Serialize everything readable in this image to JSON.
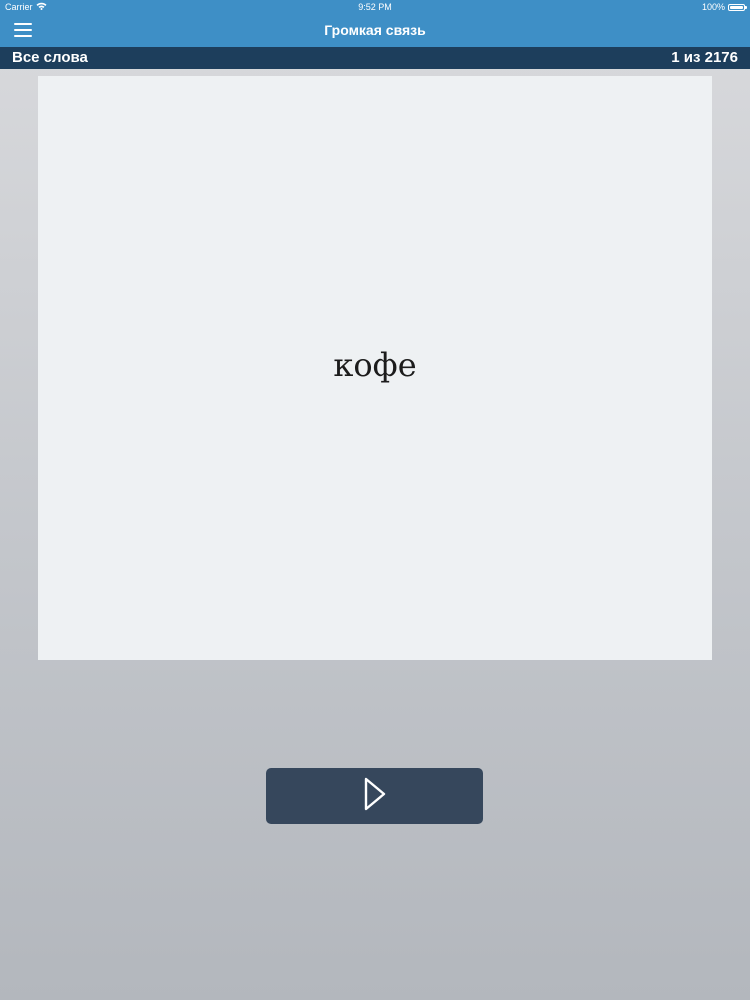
{
  "status_bar": {
    "carrier": "Carrier",
    "time": "9:52 PM",
    "battery_text": "100%",
    "battery_level": 1.0
  },
  "nav": {
    "title": "Громкая связь",
    "menu_icon": "hamburger-menu-icon"
  },
  "sub_bar": {
    "list_name": "Все слова",
    "counter": "1 из 2176"
  },
  "card": {
    "word": "кофе"
  },
  "controls": {
    "play_icon": "play-icon"
  },
  "colors": {
    "nav_background": "#3e8fc6",
    "sub_bar_background": "#1d3e5c",
    "card_background": "#eef1f3",
    "play_button_background": "#36475c"
  }
}
